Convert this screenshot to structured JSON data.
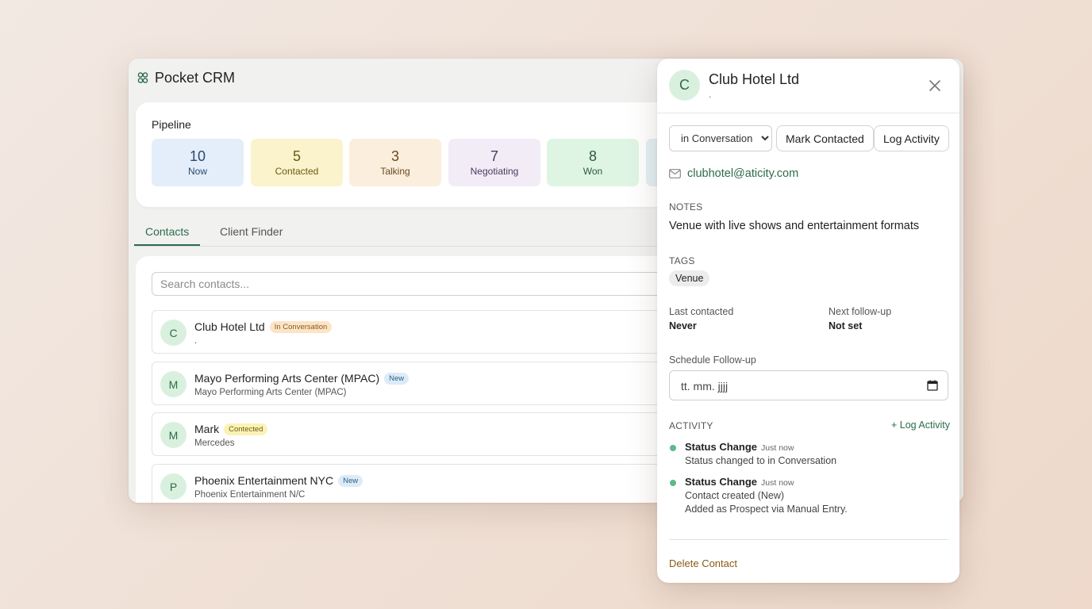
{
  "app": {
    "title": "Pocket CRM",
    "logo_icon": "people-icon"
  },
  "pipeline": {
    "title": "Pipeline",
    "stages": [
      {
        "count": "10",
        "label": "Now",
        "bg": "#e3eefa",
        "fg": "#2b4a6b"
      },
      {
        "count": "5",
        "label": "Contacted",
        "bg": "#faf3cc",
        "fg": "#6b5a15"
      },
      {
        "count": "3",
        "label": "Talking",
        "bg": "#fbeedd",
        "fg": "#6b4a1e"
      },
      {
        "count": "7",
        "label": "Negotiating",
        "bg": "#f2ecf7",
        "fg": "#4a3a5e"
      },
      {
        "count": "8",
        "label": "Won",
        "bg": "#dff5e4",
        "fg": "#2d5a3c"
      }
    ]
  },
  "tabs": [
    {
      "label": "Contacts",
      "active": true
    },
    {
      "label": "Client Finder",
      "active": false
    }
  ],
  "search": {
    "placeholder": "Search contacts..."
  },
  "contacts": [
    {
      "initial": "C",
      "name": "Club Hotel Ltd",
      "badge": "In Conversation",
      "sub": "."
    },
    {
      "initial": "M",
      "name": "Mayo Performing Arts Center (MPAC)",
      "badge": "New",
      "sub": "Mayo Performing Arts Center (MPAC)"
    },
    {
      "initial": "M",
      "name": "Mark",
      "badge": "Contected",
      "sub": "Mercedes"
    },
    {
      "initial": "P",
      "name": "Phoenix Entertainment NYC",
      "badge": "New",
      "sub": "Phoenix Entertainment N/C"
    }
  ],
  "panel": {
    "initial": "C",
    "name": "Club Hotel Ltd",
    "sub": ".",
    "close_icon": "close-icon",
    "status_selected": "in Conversation",
    "mark_contacted_label": "Mark Contacted",
    "log_activity_label": "Log Activity",
    "email": "clubhotel@aticity.com",
    "email_icon": "mail-icon",
    "notes_label": "NOTES",
    "notes": "Venue with live shows and entertainment formats",
    "tags_label": "TAGS",
    "tags": [
      "Venue"
    ],
    "last_contacted_label": "Last contacted",
    "last_contacted_value": "Never",
    "next_followup_label": "Next follow-up",
    "next_followup_value": "Not set",
    "schedule_label": "Schedule Follow-up",
    "date_placeholder": "tt. mm. jjjj",
    "calendar_icon": "calendar-icon",
    "activity_label": "ACTIVITY",
    "log_activity_link": "+ Log Activity",
    "activities": [
      {
        "title": "Status Change",
        "time": "Just now",
        "lines": [
          "Status changed to in Conversation"
        ]
      },
      {
        "title": "Status Change",
        "time": "Just now",
        "lines": [
          "Contact created (New)",
          "Added as Prospect via Manual Entry."
        ]
      }
    ],
    "delete_label": "Delete Contact"
  },
  "colors": {
    "accent": "#2d6b4c",
    "avatar_bg": "#d9f0df",
    "delete": "#8a5a12"
  }
}
